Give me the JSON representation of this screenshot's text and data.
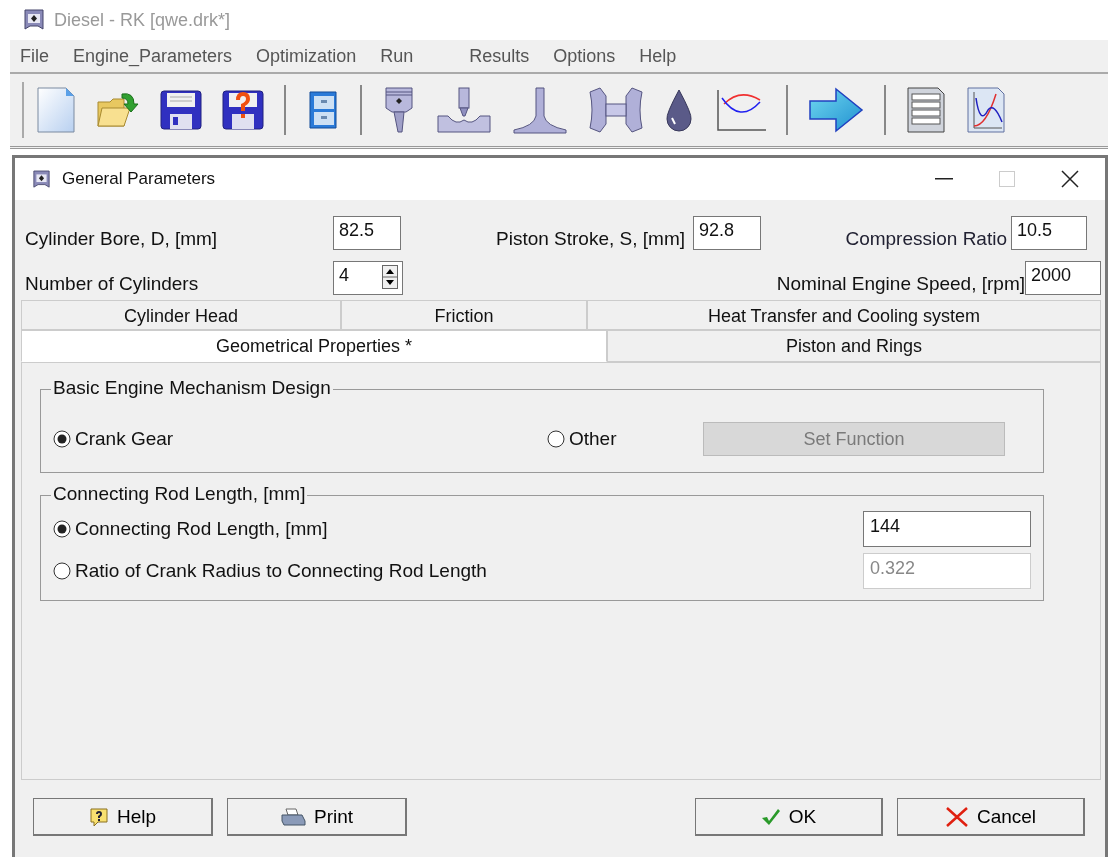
{
  "app": {
    "title": "Diesel - RK  [qwe.drk*]"
  },
  "menu": [
    "File",
    "Engine_Parameters",
    "Optimization",
    "Run",
    "Results",
    "Options",
    "Help"
  ],
  "toolbar_groups": [
    [
      {
        "kind": "new"
      },
      {
        "kind": "open"
      },
      {
        "kind": "save"
      },
      {
        "kind": "saveas"
      }
    ],
    [
      {
        "kind": "cabinet"
      }
    ],
    [
      {
        "kind": "piston"
      },
      {
        "kind": "injector"
      },
      {
        "kind": "valve"
      },
      {
        "kind": "turbo"
      },
      {
        "kind": "drop"
      },
      {
        "kind": "curves"
      }
    ],
    [
      {
        "kind": "arrow"
      }
    ],
    [
      {
        "kind": "report"
      },
      {
        "kind": "graph"
      }
    ]
  ],
  "dialog": {
    "title": "General Parameters",
    "params": {
      "bore": {
        "label": "Cylinder Bore, D, [mm]",
        "value": "82.5"
      },
      "stroke": {
        "label": "Piston Stroke, S, [mm]",
        "value": "92.8"
      },
      "compression": {
        "label": "Compression Ratio",
        "value": "10.5"
      },
      "cylinders": {
        "label": "Number of Cylinders",
        "value": "4"
      },
      "speed": {
        "label": "Nominal Engine Speed, [rpm]",
        "value": "2000"
      }
    },
    "tab_rows": [
      [
        {
          "label": "Cylinder Head",
          "selected": false
        },
        {
          "label": "Friction",
          "selected": false
        },
        {
          "label": "Heat Transfer and Cooling system",
          "selected": false
        }
      ],
      [
        {
          "label": "Geometrical Properties *",
          "selected": true
        },
        {
          "label": "Piston and Rings",
          "selected": false
        }
      ]
    ],
    "mechanism": {
      "title": "Basic Engine Mechanism Design",
      "options": [
        {
          "label": "Crank Gear",
          "selected": true
        },
        {
          "label": "Other",
          "selected": false
        }
      ],
      "button": {
        "label": "Set Function",
        "disabled": true
      }
    },
    "rod": {
      "title": "Connecting Rod Length, [mm]",
      "options": [
        {
          "label": "Connecting Rod Length, [mm]",
          "selected": true,
          "value": "144",
          "disabled": false
        },
        {
          "label": "Ratio of Crank Radius to Connecting Rod Length",
          "selected": false,
          "value": "0.322",
          "disabled": true
        }
      ]
    },
    "buttons": [
      {
        "kind": "help",
        "label": "Help"
      },
      {
        "kind": "print",
        "label": "Print"
      },
      {
        "kind": "ok",
        "label": "OK"
      },
      {
        "kind": "cancel",
        "label": "Cancel"
      }
    ]
  }
}
